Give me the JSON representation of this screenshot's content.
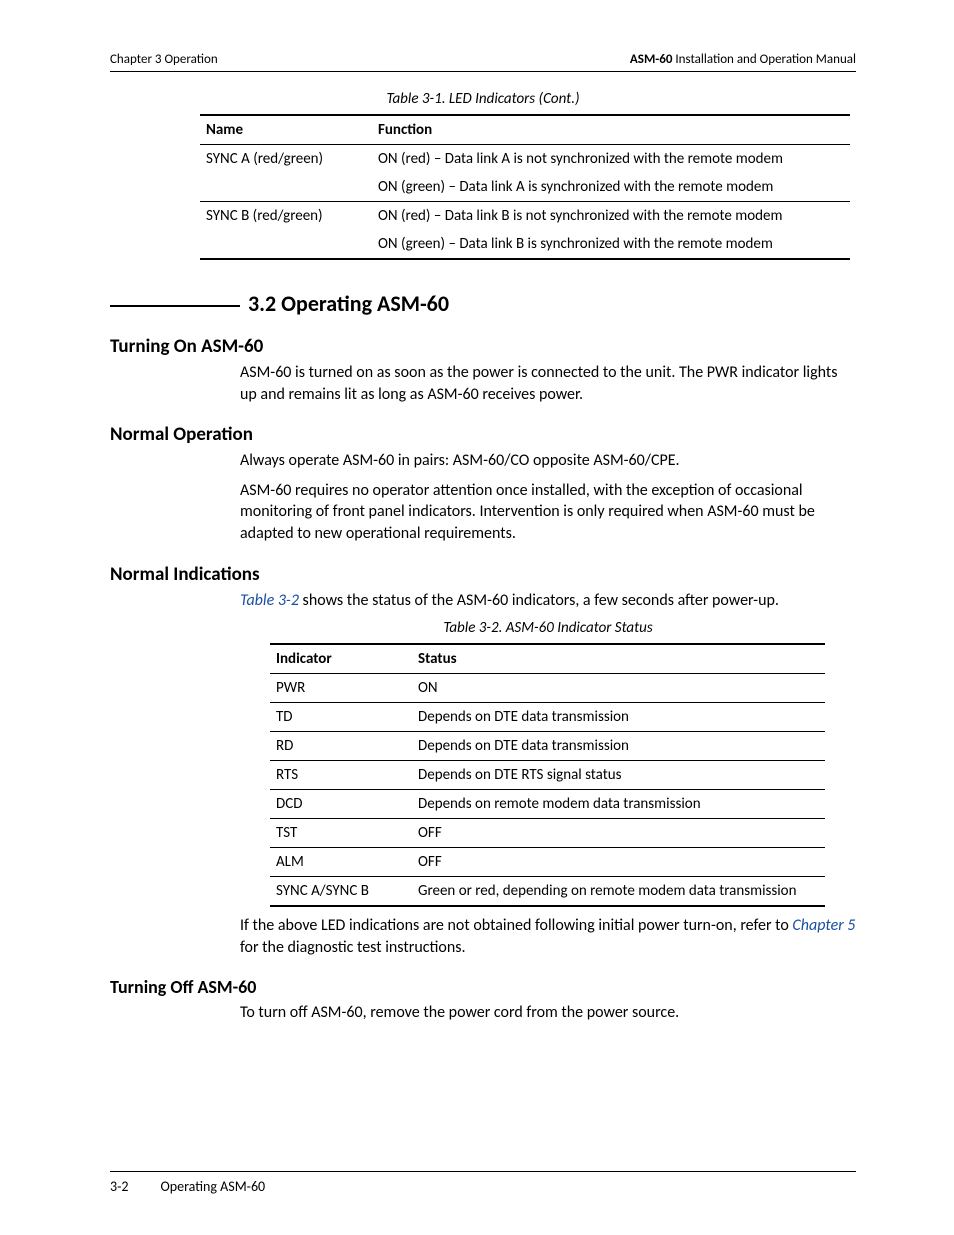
{
  "header": {
    "left": "Chapter 3  Operation",
    "right_bold": "ASM-60",
    "right_rest": " Installation and Operation Manual"
  },
  "table1": {
    "caption": "Table 3-1.  LED Indicators (Cont.)",
    "headers": [
      "Name",
      "Function"
    ],
    "rows": [
      {
        "name": "SYNC A (red/green)",
        "func": "ON (red) – Data link A is not synchronized with the remote modem"
      },
      {
        "name": "",
        "func": "ON (green) – Data link A is synchronized with the remote modem"
      },
      {
        "name": "SYNC B (red/green)",
        "func": "ON (red) – Data link B is not synchronized with the remote modem"
      },
      {
        "name": "",
        "func": "ON (green) – Data link B is synchronized with the remote modem"
      }
    ]
  },
  "h2": "3.2  Operating ASM-60",
  "sec1": {
    "title": "Turning On ASM-60",
    "text": "ASM-60 is turned on as soon as the power is connected to the unit. The PWR indicator lights up and remains lit as long as ASM-60 receives power."
  },
  "sec2": {
    "title": "Normal Operation",
    "p1": "Always operate ASM-60 in pairs: ASM-60/CO opposite ASM-60/CPE.",
    "p2": "ASM-60 requires no operator attention once installed, with the exception of occasional monitoring of front panel indicators. Intervention is only required when ASM-60 must be adapted to new operational requirements."
  },
  "sec3": {
    "title": "Normal Indications",
    "intro_link": "Table 3-2",
    "intro_rest": " shows the status of the ASM-60 indicators, a few seconds after power-up.",
    "caption": "Table 3-2.  ASM-60 Indicator Status",
    "headers": [
      "Indicator",
      "Status"
    ],
    "rows": [
      {
        "ind": "PWR",
        "st": "ON"
      },
      {
        "ind": "TD",
        "st": "Depends on DTE data transmission"
      },
      {
        "ind": "RD",
        "st": "Depends on DTE data transmission"
      },
      {
        "ind": "RTS",
        "st": "Depends on DTE RTS signal status"
      },
      {
        "ind": "DCD",
        "st": "Depends on remote modem data transmission"
      },
      {
        "ind": "TST",
        "st": "OFF"
      },
      {
        "ind": "ALM",
        "st": "OFF"
      },
      {
        "ind": "SYNC A/SYNC B",
        "st": "Green or red, depending on remote modem data transmission"
      }
    ],
    "after_pre": "If the above LED indications are not obtained following initial power turn-on, refer to ",
    "after_link": "Chapter 5",
    "after_post": " for the diagnostic test instructions."
  },
  "sec4": {
    "title": "Turning Off ASM-60",
    "text": "To turn off ASM-60, remove the power cord from the power source."
  },
  "footer": {
    "page": "3-2",
    "section": "Operating ASM-60"
  }
}
